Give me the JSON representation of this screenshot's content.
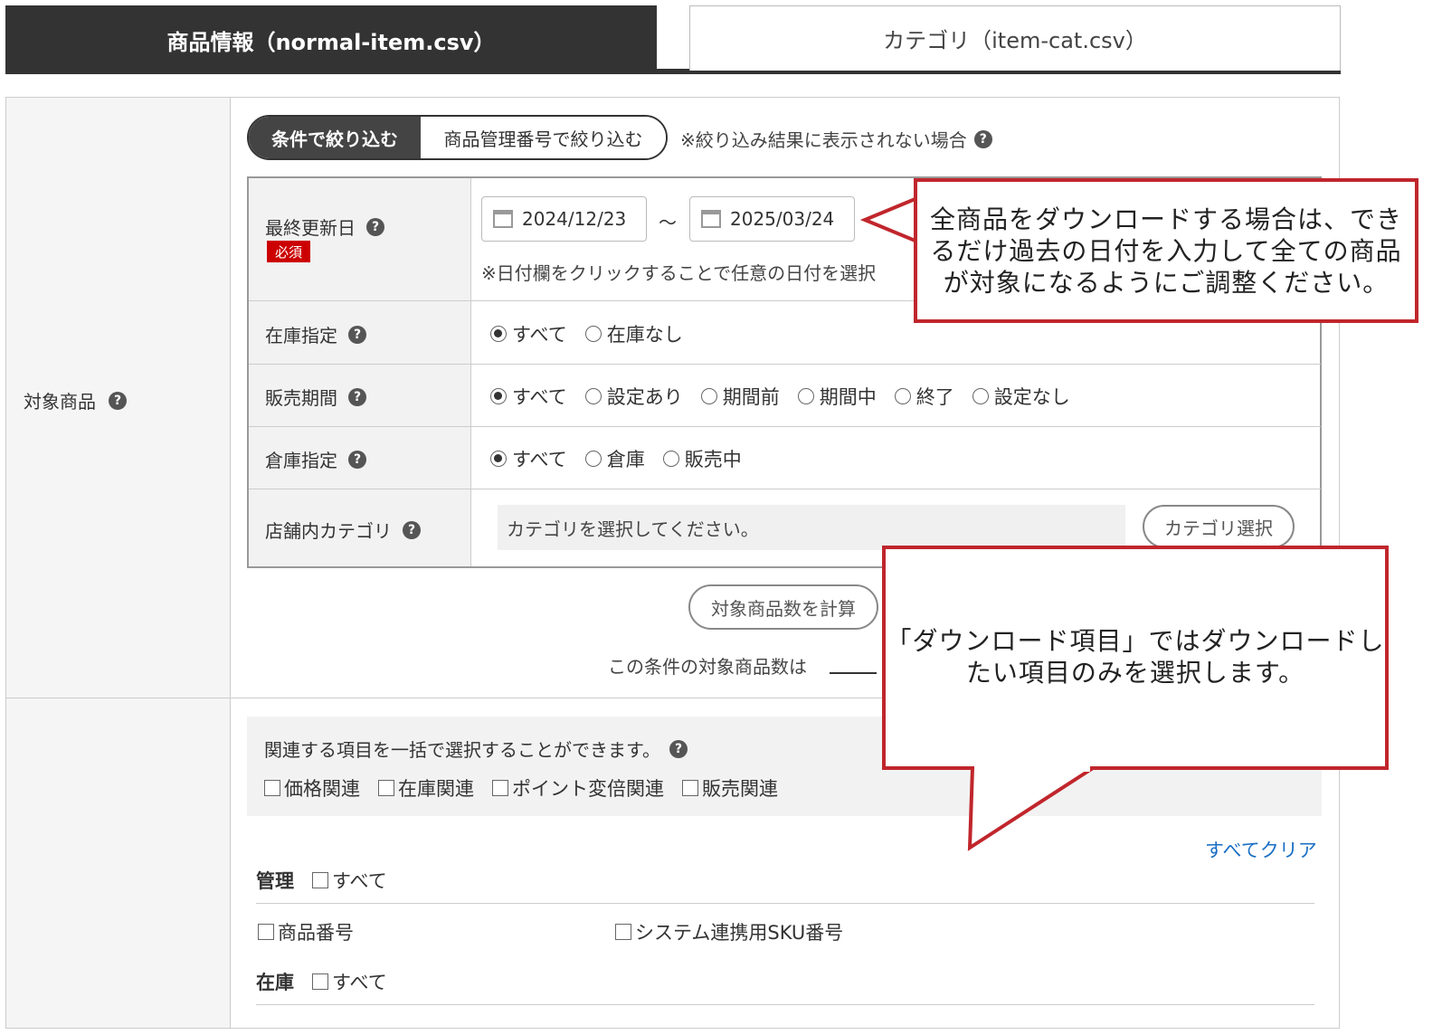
{
  "tabs": [
    {
      "label": "商品情報（normal-item.csv）",
      "active": true
    },
    {
      "label": "カテゴリ（item-cat.csv）",
      "active": false
    }
  ],
  "target": {
    "label": "対象商品",
    "filter_modes": [
      "条件で絞り込む",
      "商品管理番号で絞り込む"
    ],
    "filter_note": "※絞り込み結果に表示されない場合",
    "last_updated": {
      "label": "最終更新日",
      "required": "必須",
      "from": "2024/12/23",
      "separator": "～",
      "to": "2025/03/24",
      "note": "※日付欄をクリックすることで任意の日付を選択"
    },
    "stock": {
      "label": "在庫指定",
      "options": [
        "すべて",
        "在庫なし"
      ],
      "selected": 0
    },
    "sale_period": {
      "label": "販売期間",
      "options": [
        "すべて",
        "設定あり",
        "期間前",
        "期間中",
        "終了",
        "設定なし"
      ],
      "selected": 0
    },
    "warehouse": {
      "label": "倉庫指定",
      "options": [
        "すべて",
        "倉庫",
        "販売中"
      ],
      "selected": 0
    },
    "category": {
      "label": "店舗内カテゴリ",
      "placeholder": "カテゴリを選択してください。",
      "button": "カテゴリ選択"
    },
    "calc_button": "対象商品数を計算",
    "count_text": "この条件の対象商品数は"
  },
  "download": {
    "bulk_text": "関連する項目を一括で選択することができます。",
    "bulk_options": [
      "価格関連",
      "在庫関連",
      "ポイント変倍関連",
      "販売関連"
    ],
    "clear_all": "すべてクリア",
    "groups": [
      {
        "title": "管理",
        "all": "すべて",
        "items": [
          "商品番号",
          "システム連携用SKU番号"
        ]
      },
      {
        "title": "在庫",
        "all": "すべて",
        "items": []
      }
    ]
  },
  "callouts": {
    "first": "全商品をダウンロードする場合は、できるだけ過去の日付を入力して全ての商品が対象になるようにご調整ください。",
    "second": "「ダウンロード項目」ではダウンロードしたい項目のみを選択します。"
  },
  "colors": {
    "accent_dark": "#333333",
    "required": "#cc0000",
    "link": "#1a6fc4",
    "callout_border": "#c0262c"
  }
}
